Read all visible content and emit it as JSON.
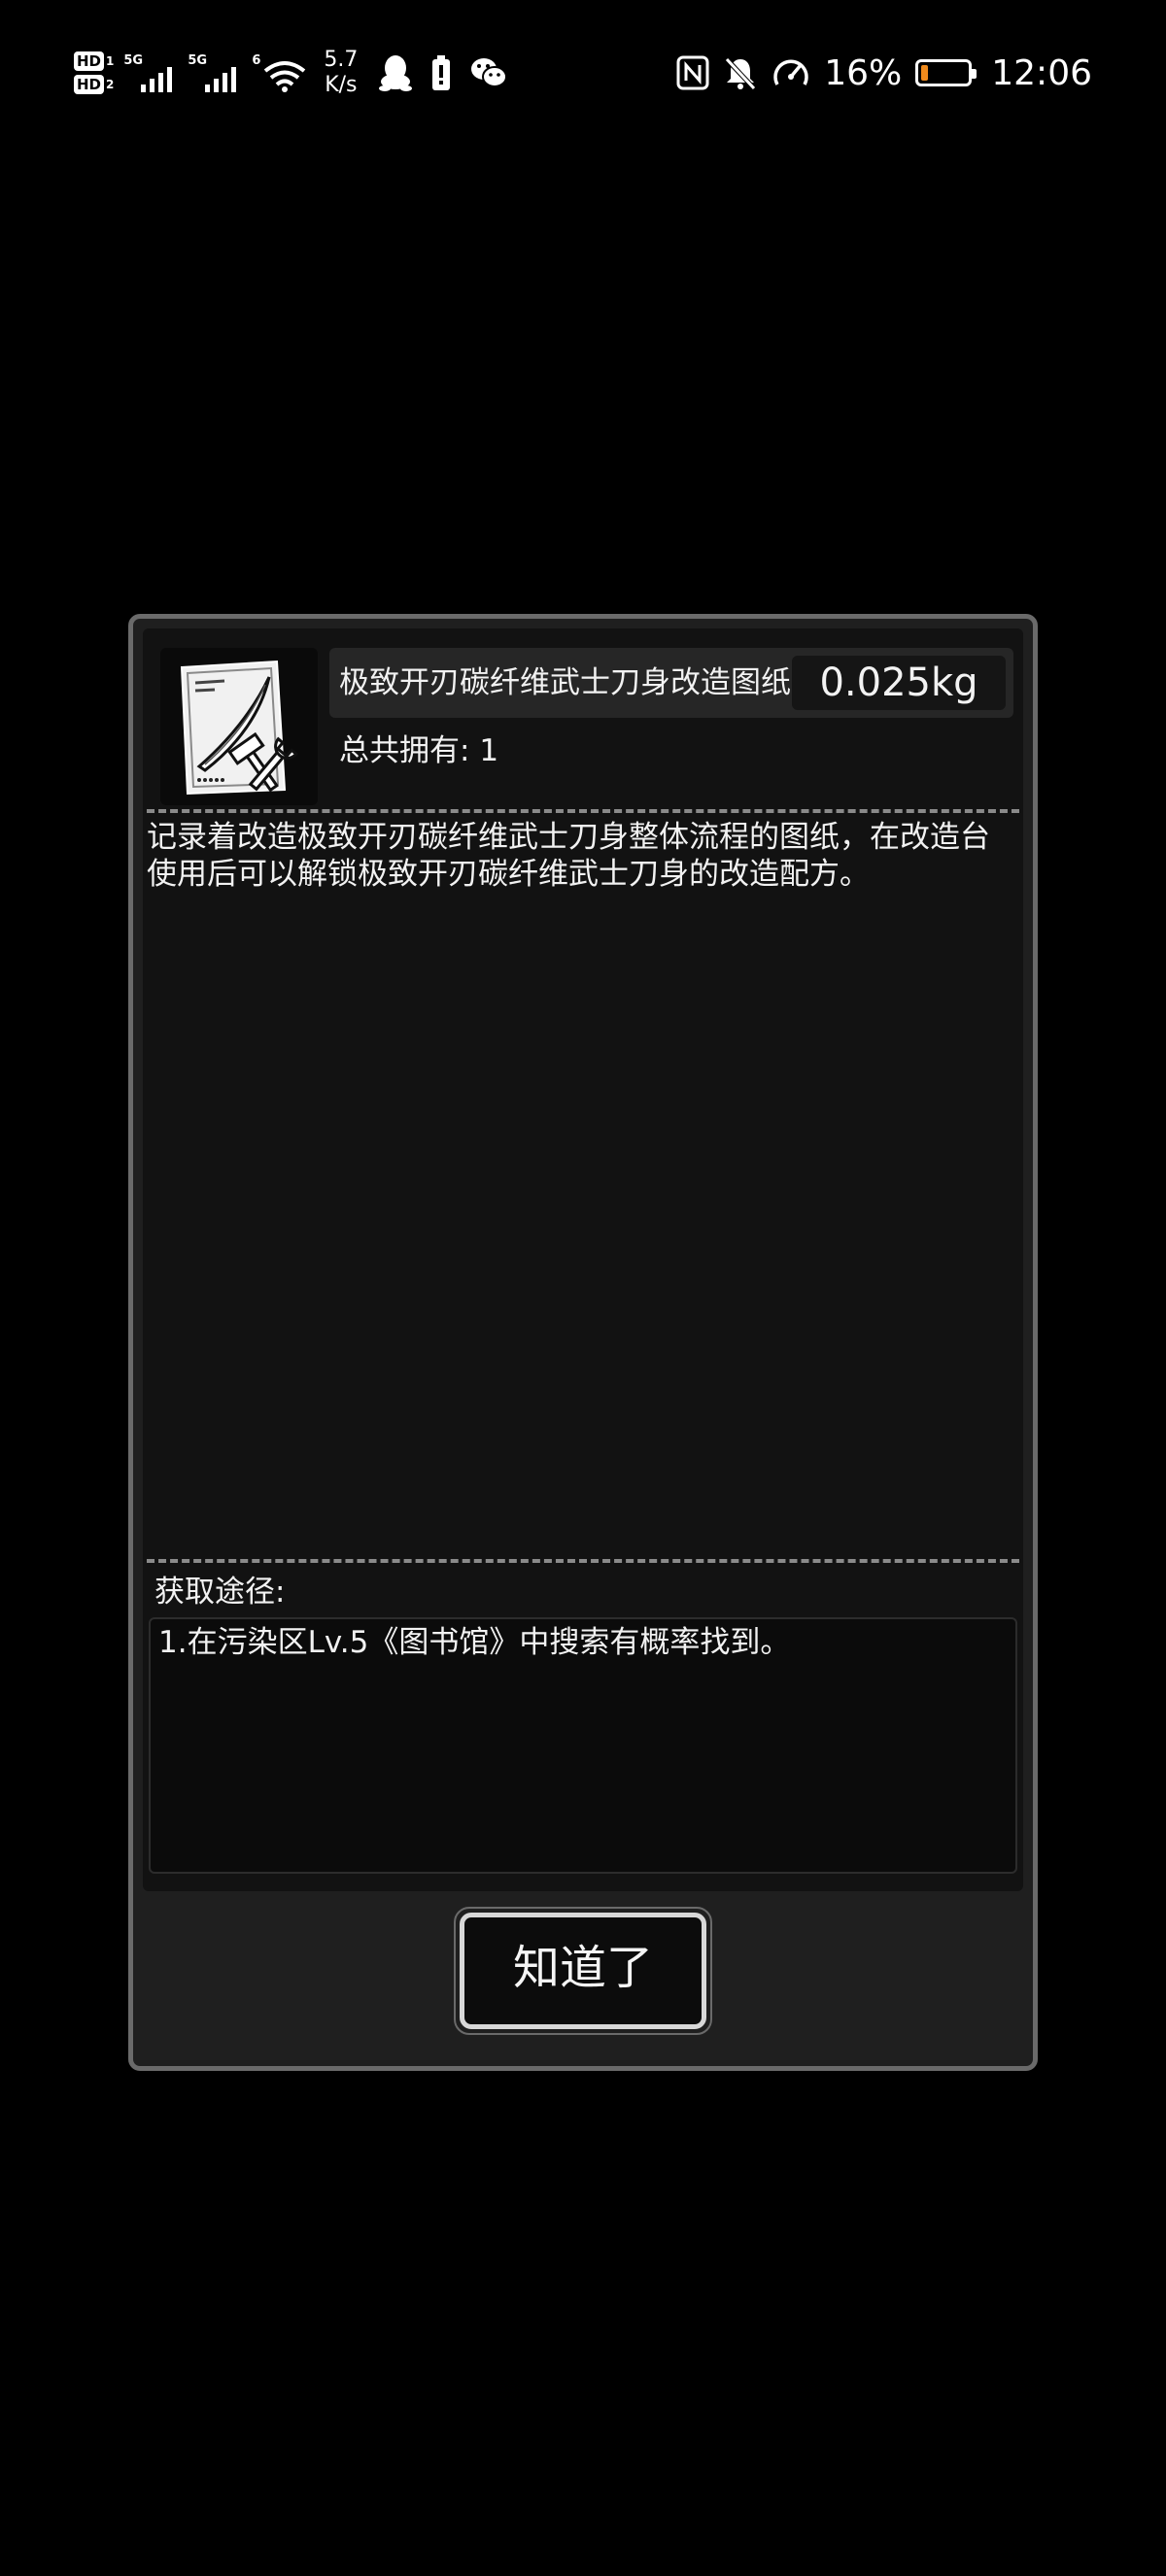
{
  "status_bar": {
    "hd1": "HD",
    "hd1_num": "1",
    "hd2": "HD",
    "hd2_num": "2",
    "sim1_gen": "5G",
    "sim2_gen": "5G",
    "wifi_gen": "6",
    "net_speed_value": "5.7",
    "net_speed_unit": "K/s",
    "battery_percent": "16%",
    "battery_level": 0.16,
    "battery_color": "#f08a1c",
    "time": "12:06",
    "icons_left": [
      "signal-icon",
      "signal-icon",
      "wifi-icon",
      "qq-icon",
      "battery-saver-icon",
      "wechat-icon"
    ],
    "icons_right": [
      "nfc-icon",
      "mute-icon",
      "speed-icon"
    ]
  },
  "dialog": {
    "item_name": "极致开刃碳纤维武士刀身改造图纸",
    "item_weight": "0.025kg",
    "owned_label": "总共拥有: ",
    "owned_count": "1",
    "description": "记录着改造极致开刃碳纤维武士刀身整体流程的图纸，在改造台使用后可以解锁极致开刃碳纤维武士刀身的改造配方。",
    "source_label": "获取途径:",
    "source_text": "1.在污染区Lv.5《图书馆》中搜索有概率找到。",
    "confirm_button": "知道了"
  }
}
